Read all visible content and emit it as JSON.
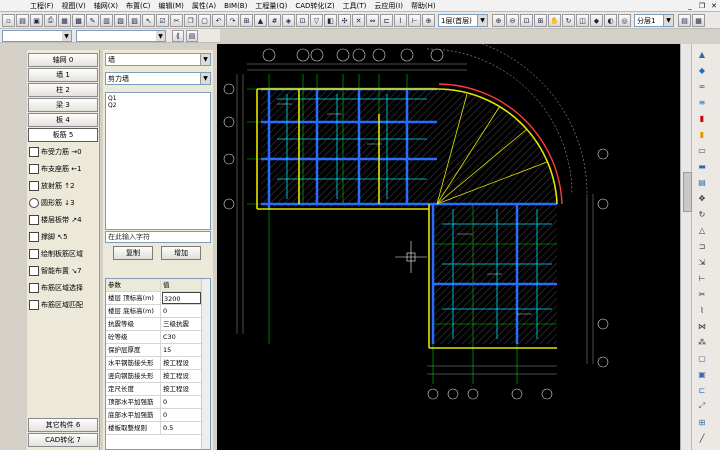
{
  "menu": {
    "items": [
      "工程(F)",
      "视图(V)",
      "轴网(X)",
      "布置(C)",
      "编辑(M)",
      "属性(A)",
      "BIM(B)",
      "工程量(Q)",
      "CAD转化(Z)",
      "工具(T)",
      "云应用(I)",
      "帮助(H)"
    ]
  },
  "window_controls": {
    "minimize": "_",
    "restore": "❐",
    "close": "✕"
  },
  "toolbar": {
    "layer_value": "1层(首层)",
    "view_value": "分层1"
  },
  "left_panel": {
    "categories": [
      "轴网 0",
      "墙 1",
      "柱 2",
      "梁 3",
      "板 4",
      "板筋 5"
    ],
    "tools": [
      "布受力筋 →0",
      "布支座筋 ←1",
      "放射筋 ↑2",
      "圆形筋 ↓3",
      "楼层板带 ↗4",
      "撑脚 ↖5",
      "绘制板筋区域",
      "智能布置 ↘7",
      "布筋区域选择",
      "布筋区域匹配"
    ],
    "bottom_categories": [
      "其它构件 6",
      "CAD转化 7"
    ]
  },
  "property_panel": {
    "type_combo": "墙",
    "subtype_combo": "剪力墙",
    "list_items": [
      "Q1",
      "Q2"
    ],
    "input_placeholder": "在此输入字符",
    "copy_button": "复制",
    "add_button": "增加",
    "table_header": {
      "key": "参数",
      "value": "值"
    },
    "rows": [
      {
        "key": "楼层 顶标高(m)",
        "value": "3200"
      },
      {
        "key": "楼层 底标高(m)",
        "value": "0"
      },
      {
        "key": "抗震等级",
        "value": "三级抗震"
      },
      {
        "key": "砼等级",
        "value": "C30"
      },
      {
        "key": "保护层厚度",
        "value": "15"
      },
      {
        "key": "水平钢筋接头形",
        "value": "按工程设"
      },
      {
        "key": "竖向钢筋接头形",
        "value": "按工程设"
      },
      {
        "key": "定尺长度",
        "value": "按工程设"
      },
      {
        "key": "顶部水平加强筋",
        "value": "0"
      },
      {
        "key": "底部水平加强筋",
        "value": "0"
      },
      {
        "key": "楼板取整规则",
        "value": "0.5"
      }
    ]
  },
  "colors": {
    "canvas_bg": "#000000",
    "grid_green": "#00c800",
    "wall_yellow": "#e6e600",
    "beam_blue": "#2a6cff",
    "hatch_cyan": "#00c8ff",
    "arc_red": "#ff3c3c",
    "dim_white": "#d8d8d8"
  },
  "icons": [
    "menu-app-icon",
    "new-icon",
    "open-icon",
    "save-icon",
    "print-icon",
    "cut-icon",
    "copy-icon",
    "paste-icon",
    "undo-icon",
    "redo-icon",
    "zoom-in-icon",
    "zoom-out-icon",
    "pan-icon",
    "rotate-icon",
    "mirror-icon",
    "layer-icon",
    "scroll-arrow-icon"
  ]
}
